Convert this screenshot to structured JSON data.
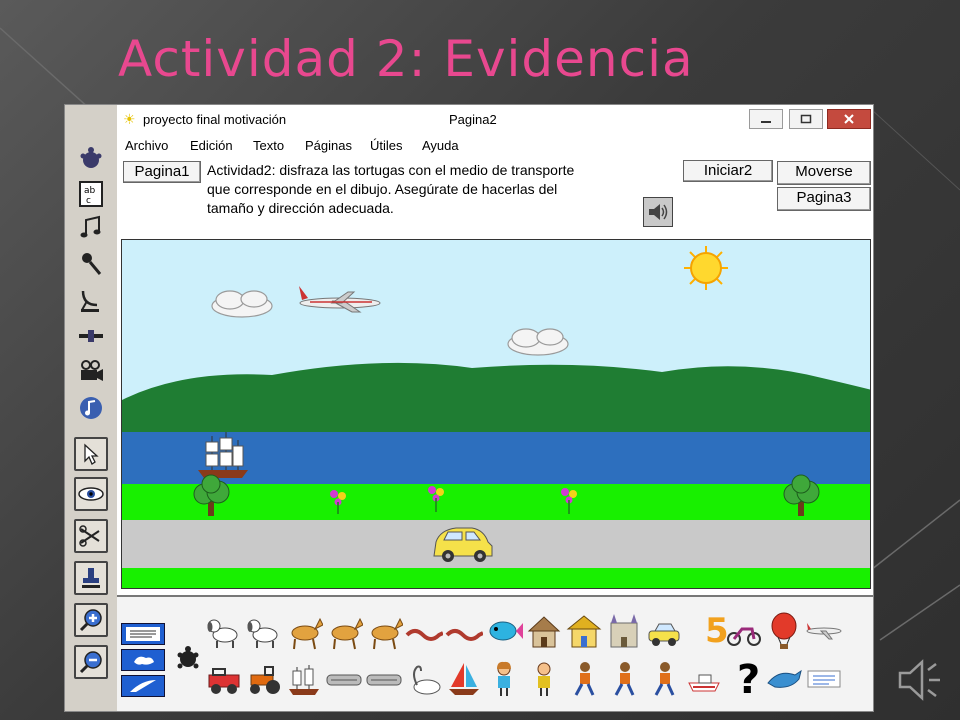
{
  "slide": {
    "title": "Actividad 2: Evidencia"
  },
  "window": {
    "app_name": "proyecto final motivación",
    "page_name": "Pagina2",
    "controls": [
      "minimize-icon",
      "maximize-icon",
      "close-icon"
    ]
  },
  "menu": {
    "items": [
      "Archivo",
      "Edición",
      "Texto",
      "Páginas",
      "Útiles",
      "Ayuda"
    ]
  },
  "page": {
    "prev_button": "Pagina1",
    "instructions_lines": [
      "Actividad2: disfraza las tortugas con el medio de transporte",
      "que corresponde en el dibujo. Asegúrate de hacerlas del",
      "tamaño y dirección adecuada."
    ],
    "start_button": "Iniciar2",
    "move_button": "Moverse",
    "next_button": "Pagina3",
    "sound_icon": "speaker-icon"
  },
  "toolbar": {
    "tools": [
      "turtle-icon",
      "text-box-icon",
      "music-note-icon",
      "microphone-icon",
      "satellite-dish-icon",
      "slider-icon",
      "camera-icon",
      "melody-icon",
      "pointer-icon",
      "eye-icon",
      "scissors-icon",
      "stamp-icon",
      "zoom-in-icon",
      "zoom-out-icon"
    ]
  },
  "scene": {
    "elements": [
      "sun",
      "cloud",
      "airplane",
      "cloud",
      "hills",
      "river",
      "sailing-ship",
      "grass",
      "tree",
      "flowers",
      "road",
      "car"
    ]
  },
  "palette": {
    "row1": [
      "dog",
      "dog",
      "horse",
      "horse",
      "horse",
      "snake",
      "snake",
      "fish",
      "hut",
      "house",
      "castle",
      "car",
      "five",
      "motorcycle",
      "hot-air-balloon",
      "airplane"
    ],
    "row2": [
      "jeep",
      "tractor",
      "ship",
      "train",
      "train",
      "swan",
      "sailboat",
      "girl",
      "boy",
      "runner",
      "runner",
      "runner",
      "boat",
      "question-mark",
      "dolphin",
      "card"
    ],
    "number_sticker": "5",
    "question_sticker": "?"
  },
  "colors": {
    "title": "#e8488f",
    "sky": "#cdf0fb",
    "hills": "#1f7d33",
    "river": "#2d6fbe",
    "grass": "#18f000",
    "road": "#c9c9c9",
    "sun": "#ffd82e"
  }
}
